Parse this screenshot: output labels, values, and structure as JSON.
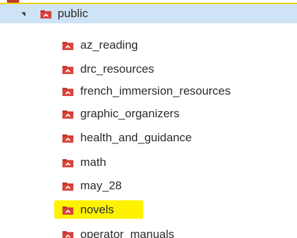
{
  "tree": {
    "root": {
      "label": "public",
      "expanded": true,
      "selected": true,
      "icon": "folder-icon"
    },
    "children": [
      {
        "label": "az_reading",
        "icon": "folder-icon"
      },
      {
        "label": "drc_resources",
        "icon": "folder-icon"
      },
      {
        "label": "french_immersion_resources",
        "icon": "folder-icon"
      },
      {
        "label": "graphic_organizers",
        "icon": "folder-icon"
      },
      {
        "label": "health_and_guidance",
        "icon": "folder-icon"
      },
      {
        "label": "math",
        "icon": "folder-icon"
      },
      {
        "label": "may_28",
        "icon": "folder-icon"
      },
      {
        "label": "novels",
        "icon": "folder-icon",
        "highlighted": true
      },
      {
        "label": "operator_manuals",
        "icon": "folder-icon"
      }
    ]
  },
  "colors": {
    "folder": "#c0392b",
    "folder_chevron": "#ffffff",
    "selection_bg": "#cfe3f6",
    "selection_border": "#f3d000",
    "highlight": "#fff200",
    "text": "#2b2b2b"
  }
}
